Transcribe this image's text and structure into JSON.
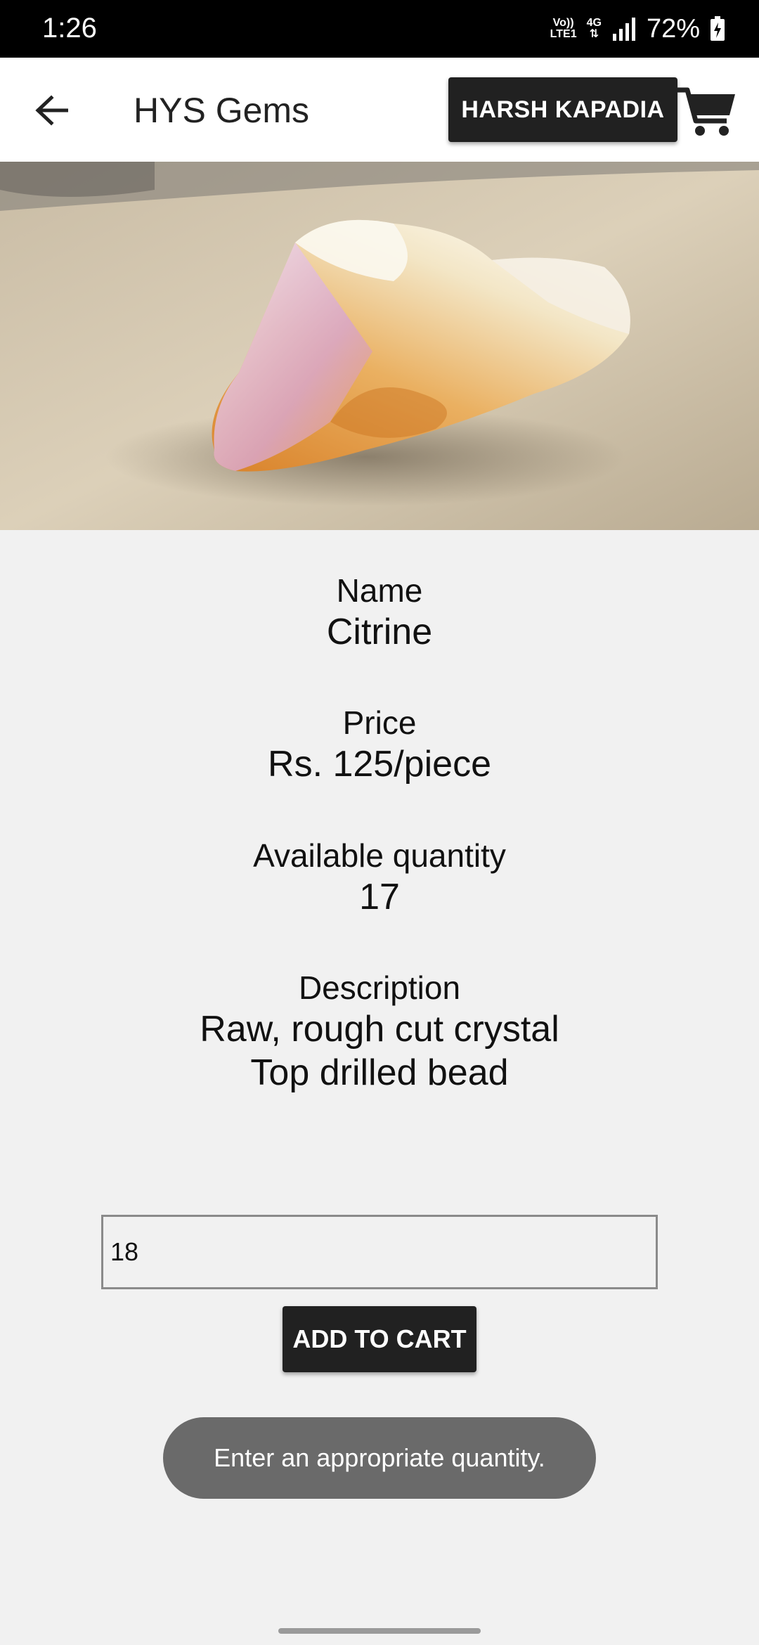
{
  "status_bar": {
    "time": "1:26",
    "network_line1": "Vo))",
    "network_line2": "LTE1",
    "network_type": "4G",
    "battery_percent": "72%"
  },
  "app_bar": {
    "title": "HYS Gems",
    "user_button_label": "HARSH KAPADIA",
    "back_icon": "arrow-left-icon",
    "cart_icon": "shopping-cart-icon"
  },
  "product": {
    "image_alt": "Citrine crystal",
    "name_label": "Name",
    "name_value": "Citrine",
    "price_label": "Price",
    "price_value": "Rs. 125/piece",
    "quantity_label": "Available quantity",
    "quantity_value": "17",
    "description_label": "Description",
    "description_line1": "Raw, rough cut crystal",
    "description_line2": "Top drilled bead"
  },
  "order": {
    "quantity_input_value": "18",
    "add_to_cart_label": "ADD TO CART"
  },
  "toast": {
    "message": "Enter an appropriate quantity."
  },
  "colors": {
    "button_bg": "#212121",
    "page_bg": "#f1f1f1",
    "toast_bg": "#6a6a6a"
  }
}
